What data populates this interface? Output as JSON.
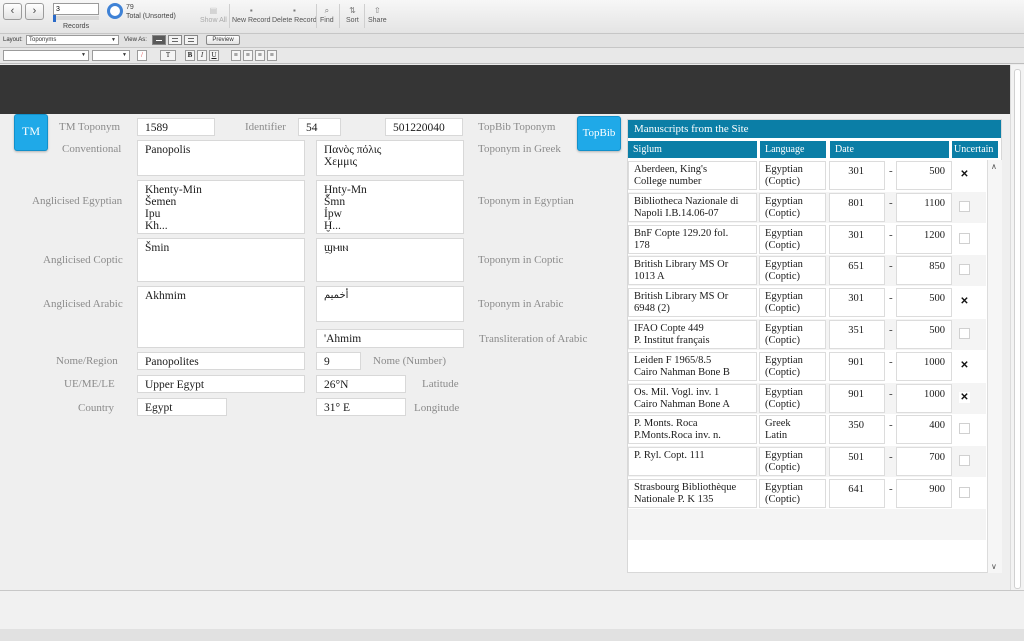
{
  "toolbar": {
    "back_icon": "chevron-left-icon",
    "forward_icon": "chevron-right-icon",
    "current_record": "3",
    "records_label": "Records",
    "total_count": "79",
    "total_label": "Total (Unsorted)",
    "show_all": "Show All",
    "new_record": "New Record",
    "delete_record": "Delete Record",
    "find": "Find",
    "sort": "Sort",
    "share": "Share"
  },
  "layoutbar": {
    "layout_label": "Layout:",
    "layout_value": "Toponyms",
    "view_as_label": "View As:",
    "preview": "Preview"
  },
  "formatbar": {
    "bold": "B",
    "italic": "I",
    "underline": "U"
  },
  "form": {
    "tm_button": "TM",
    "tm_toponym_label": "TM Toponym",
    "tm_toponym": "1589",
    "identifier_label": "Identifier",
    "identifier": "54",
    "topbib_value": "501220040",
    "topbib_toponym_label": "TopBib Toponym",
    "topbib_button": "TopBib",
    "conventional_label": "Conventional",
    "conventional": "Panopolis",
    "greek": "Πανὸς πόλις\nΧεμμις",
    "greek_label": "Toponym in Greek",
    "anglicised_egyptian_label": "Anglicised Egyptian",
    "anglicised_egyptian": "Khenty-Min\nŠemen\nIpu\nKh...",
    "egyptian": "Ḫnty-Mn\nŠmn\nỈpw\nḪ...",
    "egyptian_label": "Toponym in Egyptian",
    "anglicised_coptic_label": "Anglicised Coptic",
    "anglicised_coptic": "Šmin",
    "coptic": "ϣⲙⲓⲛ",
    "coptic_label": "Toponym in Coptic",
    "anglicised_arabic_label": "Anglicised Arabic",
    "anglicised_arabic": "Akhmim",
    "arabic": "أخميم",
    "arabic_label": "Toponym in Arabic",
    "transliteration_arabic": "'Ahmim",
    "transliteration_arabic_label": "Transliteration of Arabic",
    "nome_region_label": "Nome/Region",
    "nome_region": "Panopolites",
    "nome_number": "9",
    "nome_number_label": "Nome (Number)",
    "ue_me_le_label": "UE/ME/LE",
    "ue_me_le": "Upper Egypt",
    "latitude": "26°N",
    "latitude_label": "Latitude",
    "country_label": "Country",
    "country": "Egypt",
    "longitude": "31° E",
    "longitude_label": "Longitude"
  },
  "portal": {
    "title": "Manuscripts from the Site",
    "headers": {
      "siglum": "Siglum",
      "language": "Language",
      "date": "Date",
      "uncertain": "Uncertain"
    },
    "rows": [
      {
        "siglum": "Aberdeen, King's\nCollege number",
        "language": "Egyptian\n(Coptic)",
        "from": "301",
        "to": "500",
        "uncertain": true
      },
      {
        "siglum": "Bibliotheca Nazionale di\nNapoli I.B.14.06-07",
        "language": "Egyptian\n(Coptic)",
        "from": "801",
        "to": "1100",
        "uncertain": false
      },
      {
        "siglum": "BnF Copte 129.20 fol.\n178",
        "language": "Egyptian\n(Coptic)",
        "from": "301",
        "to": "1200",
        "uncertain": false
      },
      {
        "siglum": "British Library MS Or\n1013 A",
        "language": "Egyptian\n(Coptic)",
        "from": "651",
        "to": "850",
        "uncertain": false
      },
      {
        "siglum": "British Library MS Or\n6948 (2)",
        "language": "Egyptian\n(Coptic)",
        "from": "301",
        "to": "500",
        "uncertain": true
      },
      {
        "siglum": "IFAO Copte 449\nP. Institut français",
        "language": "Egyptian\n(Coptic)",
        "from": "351",
        "to": "500",
        "uncertain": false
      },
      {
        "siglum": "Leiden F 1965/8.5\nCairo Nahman Bone B",
        "language": "Egyptian\n(Coptic)",
        "from": "901",
        "to": "1000",
        "uncertain": true
      },
      {
        "siglum": "Os. Mil. Vogl. inv. 1\nCairo Nahman Bone A",
        "language": "Egyptian\n(Coptic)",
        "from": "901",
        "to": "1000",
        "uncertain": true
      },
      {
        "siglum": "P. Monts. Roca\nP.Monts.Roca inv. n.",
        "language": "Greek\nLatin",
        "from": "350",
        "to": "400",
        "uncertain": false
      },
      {
        "siglum": "P. Ryl. Copt. 111",
        "language": "Egyptian\n(Coptic)",
        "from": "501",
        "to": "700",
        "uncertain": false
      },
      {
        "siglum": "Strasbourg Bibliothèque\nNationale P. K 135",
        "language": "Egyptian\n(Coptic)",
        "from": "641",
        "to": "900",
        "uncertain": false
      }
    ]
  }
}
